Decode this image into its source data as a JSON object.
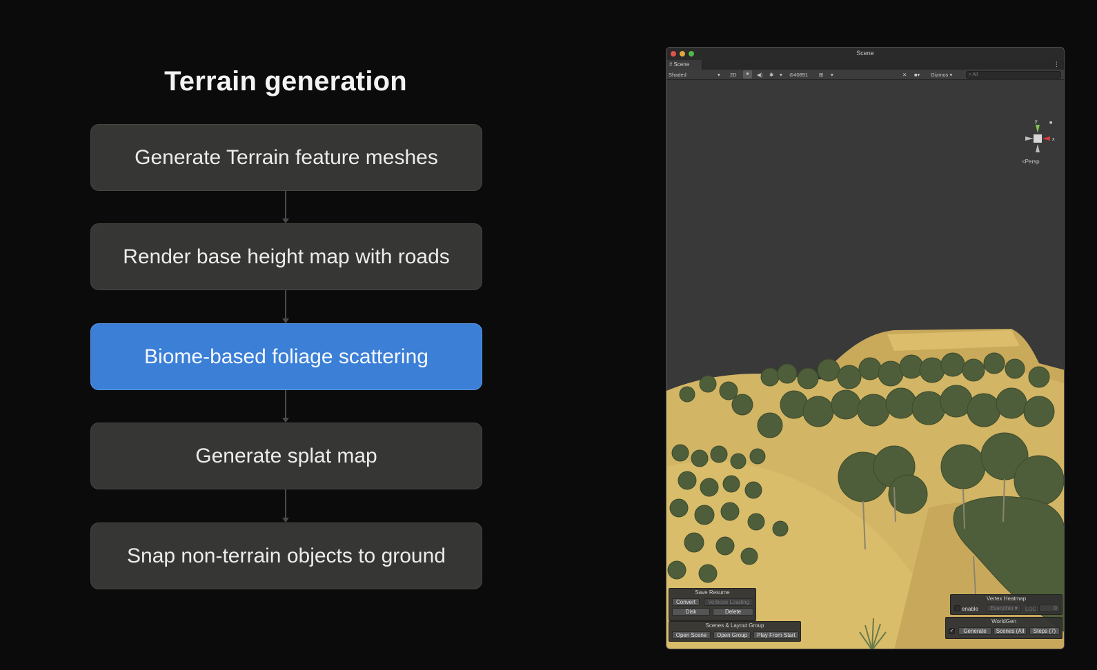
{
  "slide": {
    "title": "Terrain generation",
    "steps": [
      {
        "label": "Generate Terrain feature meshes",
        "active": false
      },
      {
        "label": "Render base height map with roads",
        "active": false
      },
      {
        "label": "Biome-based foliage scattering",
        "active": true
      },
      {
        "label": "Generate splat map",
        "active": false
      },
      {
        "label": "Snap non-terrain objects to ground",
        "active": false
      }
    ],
    "active_color": "#3b7fd6",
    "box_color": "#363735"
  },
  "window": {
    "title": "Scene",
    "traffic_lights": [
      "#e0524b",
      "#e0a93a",
      "#4fb84a"
    ],
    "tab": {
      "label": "Scene",
      "icon": "hash-icon"
    },
    "more_icon": "kebab-menu-icon",
    "toolbar": {
      "shading_mode": "Shaded",
      "two_d": "2D",
      "hidden_count": "40891",
      "gizmos": "Gizmos",
      "search_placeholder": "All",
      "icons": [
        "lightbulb-icon",
        "speaker-icon",
        "effects-icon",
        "visibility-icon",
        "grid-icon",
        "tools-icon",
        "camera-icon",
        "search-icon"
      ]
    },
    "scene": {
      "orientation": {
        "y_label": "y",
        "x_label": "x",
        "view_label": "<Persp",
        "lock_icon": "lock-icon"
      },
      "colors": {
        "sky": "#393939",
        "terrain": "#d2b565",
        "foliage": "#4e5e3a"
      }
    },
    "overlays": {
      "save_resume": {
        "title": "Save Resume",
        "convert": "Convert",
        "verbose_loading": "Verbose Loading",
        "disk": "Disk",
        "delete": "Delete"
      },
      "scenes_layout": {
        "title": "Scenes & Layout Group",
        "open_scene": "Open Scene",
        "open_group": "Open Group",
        "play_from_start": "Play From Start"
      },
      "vertex_heatmap": {
        "title": "Vertex Heatmap",
        "enable": "enable",
        "everything": "Everythin",
        "lod_label": "LOD:",
        "lod_value": "0"
      },
      "worldgen": {
        "title": "WorldGen",
        "generate": "Generate",
        "scenes": "Scenes (All",
        "steps": "Steps (7)"
      }
    }
  }
}
